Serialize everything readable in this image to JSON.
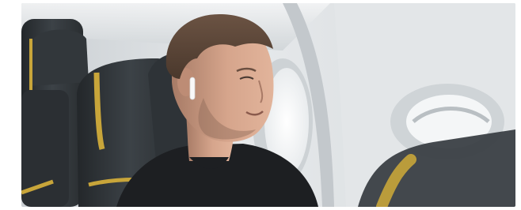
{
  "photo": {
    "subject": "man-wearing-wireless-earbuds-in-airplane-seat",
    "palette": {
      "cabin_wall": "#dfe3e6",
      "seat_leather": "#2f3438",
      "seat_trim": "#c8a53a",
      "skin": "#c99a82",
      "hair": "#5a4536",
      "shirt": "#1d1f22",
      "window_glow": "#f6f7f8"
    }
  }
}
